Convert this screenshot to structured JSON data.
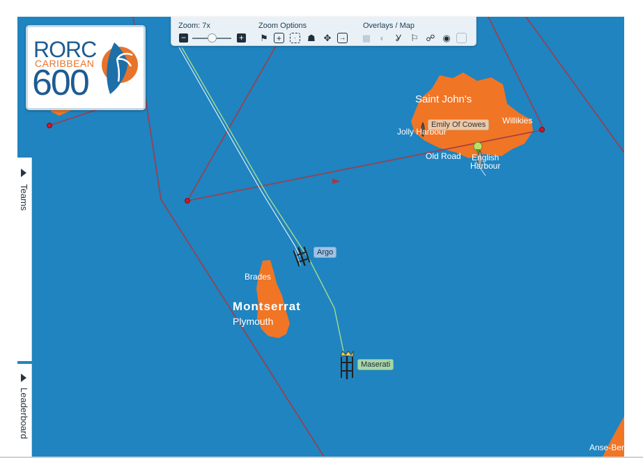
{
  "logo": {
    "line1": "RORC",
    "line2": "CARIBBEAN",
    "line3": "600"
  },
  "toolbar": {
    "zoom_label": "Zoom: 7x",
    "zoom_level_fraction": 0.5,
    "zoom_options_label": "Zoom Options",
    "overlays_label": "Overlays / Map"
  },
  "side_tabs": {
    "teams": "Teams",
    "leaderboard": "Leaderboard"
  },
  "map_labels": {
    "saint_johns": "Saint John's",
    "jolly_harbour": "Jolly Harbour",
    "willikies": "Willikies",
    "old_road": "Old Road",
    "english": "English",
    "harbour": "Harbour",
    "brades": "Brades",
    "montserrat": "Montserrat",
    "plymouth": "Plymouth",
    "anse_bert": "Anse-Bert"
  },
  "boats": {
    "argo": "Argo",
    "maserati": "Maserati",
    "emily": "Emily Of Cowes"
  },
  "colors": {
    "sea": "#1f84c0",
    "land": "#f07525",
    "course_line": "#a23b46",
    "track_green": "#a8dc8a",
    "track_white": "#dfeef8"
  }
}
